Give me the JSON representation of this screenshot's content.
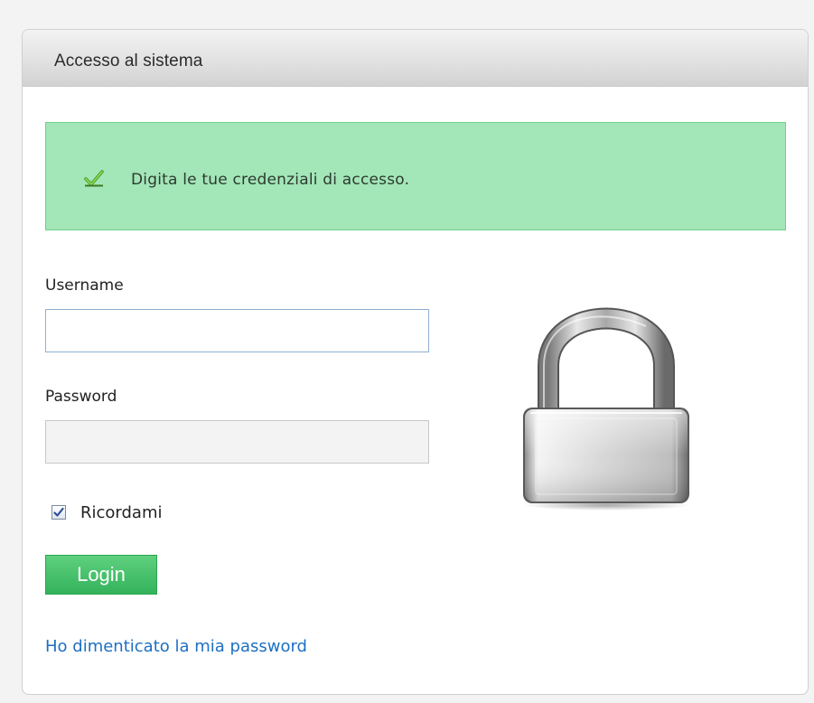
{
  "panel": {
    "title": "Accesso al sistema"
  },
  "message": {
    "text": "Digita le tue credenziali di accesso.",
    "icon": "check-icon"
  },
  "form": {
    "username_label": "Username",
    "username_value": "",
    "password_label": "Password",
    "password_value": "",
    "remember_label": "Ricordami",
    "remember_checked": true,
    "login_label": "Login",
    "forgot_label": "Ho dimenticato la mia password"
  },
  "illustration": {
    "icon": "padlock-icon"
  },
  "colors": {
    "message_bg": "#a3e6b8",
    "button_bg": "#33b35b",
    "link": "#1d6fc2"
  }
}
